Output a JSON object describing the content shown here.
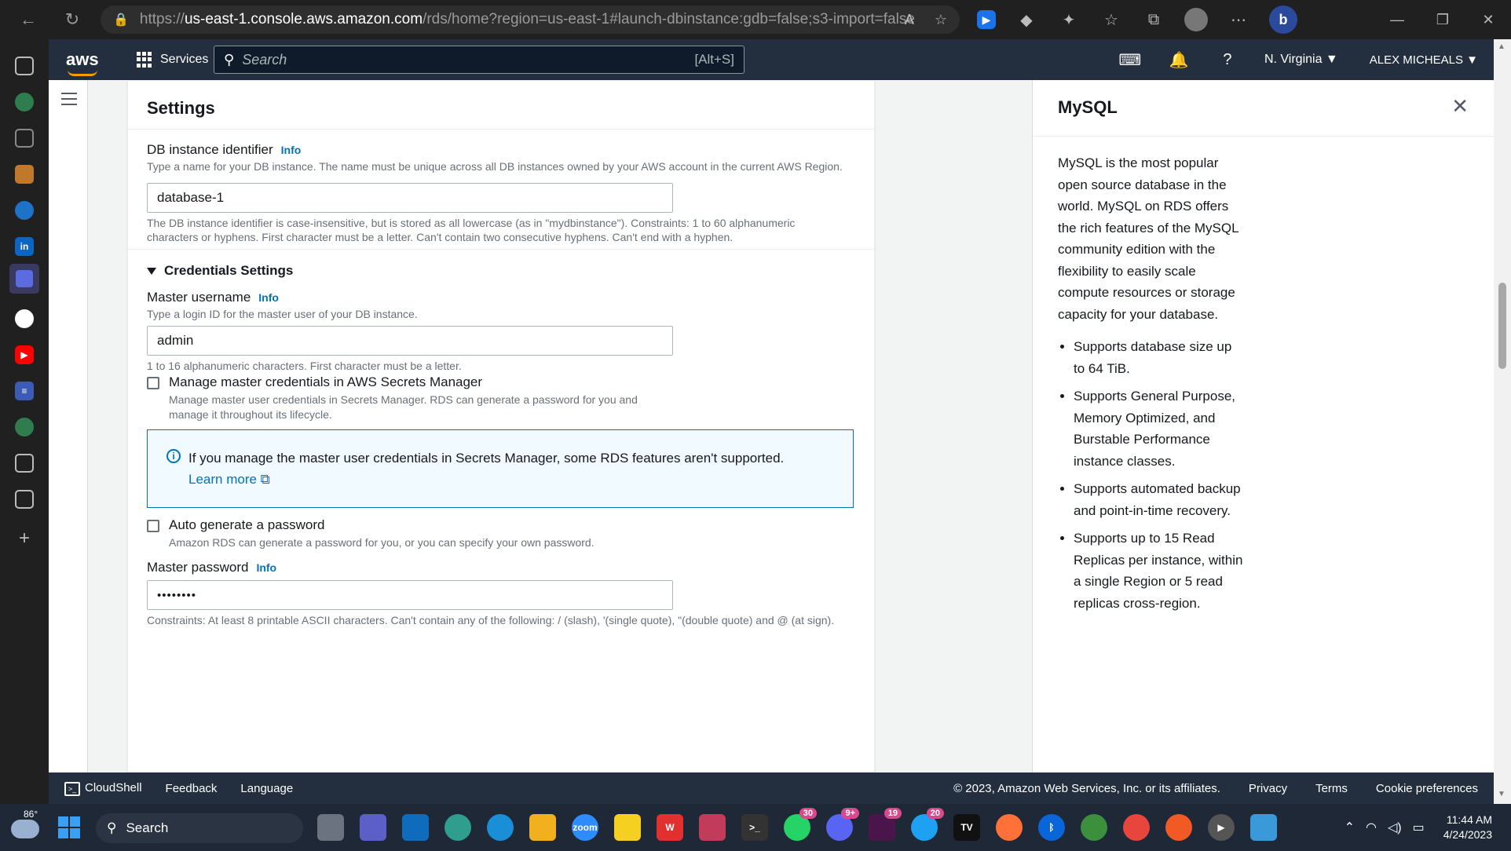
{
  "browser": {
    "url_host": "us-east-1.console.aws.amazon.com",
    "url_prefix": "https://",
    "url_path": "/rds/home?region=us-east-1#launch-dbinstance:gdb=false;s3-import=false"
  },
  "aws": {
    "services_label": "Services",
    "search_placeholder": "Search",
    "search_shortcut": "[Alt+S]",
    "region": "N. Virginia",
    "user": "ALEX MICHEALS"
  },
  "settings": {
    "title": "Settings",
    "db_id_label": "DB instance identifier",
    "info": "Info",
    "db_id_desc": "Type a name for your DB instance. The name must be unique across all DB instances owned by your AWS account in the current AWS Region.",
    "db_id_value": "database-1",
    "db_id_constraints": "The DB instance identifier is case-insensitive, but is stored as all lowercase (as in \"mydbinstance\"). Constraints: 1 to 60 alphanumeric characters or hyphens. First character must be a letter. Can't contain two consecutive hyphens. Can't end with a hyphen.",
    "credentials_title": "Credentials Settings",
    "master_user_label": "Master username",
    "master_user_desc": "Type a login ID for the master user of your DB instance.",
    "master_user_value": "admin",
    "master_user_constraints": "1 to 16 alphanumeric characters. First character must be a letter.",
    "manage_label": "Manage master credentials in AWS Secrets Manager",
    "manage_desc": "Manage master user credentials in Secrets Manager. RDS can generate a password for you and manage it throughout its lifecycle.",
    "alert_text": "If you manage the master user credentials in Secrets Manager, some RDS features aren't supported.",
    "learn_more": "Learn more",
    "auto_label": "Auto generate a password",
    "auto_desc": "Amazon RDS can generate a password for you, or you can specify your own password.",
    "password_label": "Master password",
    "password_value": "••••••••",
    "password_constraints": "Constraints: At least 8 printable ASCII characters. Can't contain any of the following: / (slash), '(single quote), \"(double quote) and @ (at sign)."
  },
  "help": {
    "title": "MySQL",
    "intro": "MySQL is the most popular open source database in the world. MySQL on RDS offers the rich features of the MySQL community edition with the flexibility to easily scale compute resources or storage capacity for your database.",
    "bullets": [
      "Supports database size up to 64 TiB.",
      "Supports General Purpose, Memory Optimized, and Burstable Performance instance classes.",
      "Supports automated backup and point-in-time recovery.",
      "Supports up to 15 Read Replicas per instance, within a single Region or 5 read replicas cross-region."
    ]
  },
  "footer": {
    "cloudshell": "CloudShell",
    "feedback": "Feedback",
    "language": "Language",
    "copyright": "© 2023, Amazon Web Services, Inc. or its affiliates.",
    "privacy": "Privacy",
    "terms": "Terms",
    "cookies": "Cookie preferences"
  },
  "taskbar": {
    "temp": "86°",
    "search": "Search",
    "time": "11:44 AM",
    "date": "4/24/2023",
    "badges": {
      "whatsapp": "30",
      "discord": "9+",
      "slack": "19",
      "twitter": "20"
    }
  },
  "colors": {
    "aws_header": "#232f3e",
    "aws_orange": "#ff9900",
    "link_blue": "#0073bb"
  }
}
